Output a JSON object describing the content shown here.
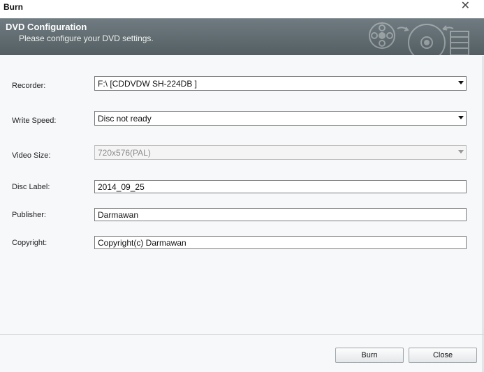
{
  "window": {
    "title": "Burn"
  },
  "header": {
    "title": "DVD Configuration",
    "subtitle": "Please configure your DVD settings."
  },
  "form": {
    "recorder": {
      "label": "Recorder:",
      "value": "F:\\ [CDDVDW SH-224DB ]"
    },
    "write_speed": {
      "label": "Write Speed:",
      "value": "Disc not ready"
    },
    "video_size": {
      "label": "Video Size:",
      "value": "720x576(PAL)"
    },
    "disc_label": {
      "label": "Disc Label:",
      "value": "2014_09_25"
    },
    "publisher": {
      "label": "Publisher:",
      "value": "Darmawan"
    },
    "copyright": {
      "label": "Copyright:",
      "value": "Copyright(c) Darmawan"
    }
  },
  "buttons": {
    "burn": "Burn",
    "close": "Close"
  }
}
